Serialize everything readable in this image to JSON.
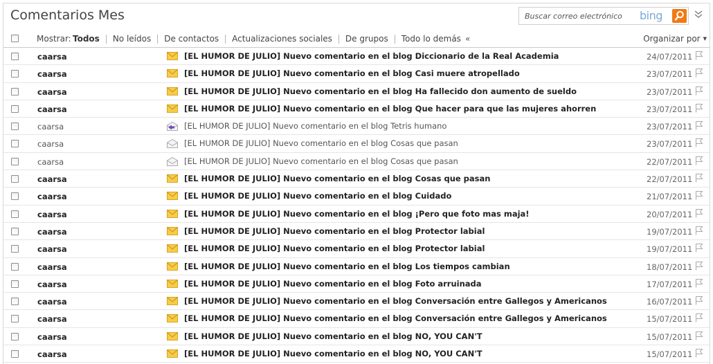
{
  "header": {
    "title": "Comentarios Mes",
    "search_placeholder": "Buscar correo electrónico",
    "search_brand": "bing"
  },
  "filterbar": {
    "show_label": "Mostrar:",
    "filters": [
      "Todos",
      "No leídos",
      "De contactos",
      "Actualizaciones sociales",
      "De grupos",
      "Todo lo demás"
    ],
    "active_filter": "Todos",
    "collapse_glyph": "«",
    "organize_label": "Organizar por"
  },
  "colors": {
    "accent_orange": "#f07a14",
    "bing_blue": "#7aa8d8",
    "envelope_unread": "#f0c23a",
    "envelope_reply": "#6a4bc4"
  },
  "messages": [
    {
      "sender": "caarsa",
      "subject": "[EL HUMOR DE JULIO] Nuevo comentario en el blog Diccionario de la Real Academia",
      "date": "24/07/2011",
      "unread": true,
      "icon": "envelope-unread-icon"
    },
    {
      "sender": "caarsa",
      "subject": "[EL HUMOR DE JULIO] Nuevo comentario en el blog Casi muere atropellado",
      "date": "23/07/2011",
      "unread": true,
      "icon": "envelope-unread-icon"
    },
    {
      "sender": "caarsa",
      "subject": "[EL HUMOR DE JULIO] Nuevo comentario en el blog Ha fallecido don aumento de sueldo",
      "date": "23/07/2011",
      "unread": true,
      "icon": "envelope-unread-icon"
    },
    {
      "sender": "caarsa",
      "subject": "[EL HUMOR DE JULIO] Nuevo comentario en el blog Que hacer para que las mujeres ahorren",
      "date": "23/07/2011",
      "unread": true,
      "icon": "envelope-unread-icon"
    },
    {
      "sender": "caarsa",
      "subject": "[EL HUMOR DE JULIO] Nuevo comentario en el blog Tetris humano",
      "date": "23/07/2011",
      "unread": false,
      "icon": "envelope-replied-icon"
    },
    {
      "sender": "caarsa",
      "subject": "[EL HUMOR DE JULIO] Nuevo comentario en el blog Cosas que pasan",
      "date": "23/07/2011",
      "unread": false,
      "icon": "envelope-open-icon"
    },
    {
      "sender": "caarsa",
      "subject": "[EL HUMOR DE JULIO] Nuevo comentario en el blog Cosas que pasan",
      "date": "22/07/2011",
      "unread": false,
      "icon": "envelope-open-icon"
    },
    {
      "sender": "caarsa",
      "subject": "[EL HUMOR DE JULIO] Nuevo comentario en el blog Cosas que pasan",
      "date": "22/07/2011",
      "unread": true,
      "icon": "envelope-unread-icon"
    },
    {
      "sender": "caarsa",
      "subject": "[EL HUMOR DE JULIO] Nuevo comentario en el blog Cuidado",
      "date": "21/07/2011",
      "unread": true,
      "icon": "envelope-unread-icon"
    },
    {
      "sender": "caarsa",
      "subject": "[EL HUMOR DE JULIO] Nuevo comentario en el blog ¡Pero que foto mas maja!",
      "date": "20/07/2011",
      "unread": true,
      "icon": "envelope-unread-icon"
    },
    {
      "sender": "caarsa",
      "subject": "[EL HUMOR DE JULIO] Nuevo comentario en el blog Protector labial",
      "date": "19/07/2011",
      "unread": true,
      "icon": "envelope-unread-icon"
    },
    {
      "sender": "caarsa",
      "subject": "[EL HUMOR DE JULIO] Nuevo comentario en el blog Protector labial",
      "date": "19/07/2011",
      "unread": true,
      "icon": "envelope-unread-icon"
    },
    {
      "sender": "caarsa",
      "subject": "[EL HUMOR DE JULIO] Nuevo comentario en el blog Los tiempos cambian",
      "date": "18/07/2011",
      "unread": true,
      "icon": "envelope-unread-icon"
    },
    {
      "sender": "caarsa",
      "subject": "[EL HUMOR DE JULIO] Nuevo comentario en el blog Foto arruinada",
      "date": "17/07/2011",
      "unread": true,
      "icon": "envelope-unread-icon"
    },
    {
      "sender": "caarsa",
      "subject": "[EL HUMOR DE JULIO] Nuevo comentario en el blog Conversación entre Gallegos y Americanos",
      "date": "16/07/2011",
      "unread": true,
      "icon": "envelope-unread-icon"
    },
    {
      "sender": "caarsa",
      "subject": "[EL HUMOR DE JULIO] Nuevo comentario en el blog Conversación entre Gallegos y Americanos",
      "date": "15/07/2011",
      "unread": true,
      "icon": "envelope-unread-icon"
    },
    {
      "sender": "caarsa",
      "subject": "[EL HUMOR DE JULIO] Nuevo comentario en el blog NO, YOU CAN'T",
      "date": "15/07/2011",
      "unread": true,
      "icon": "envelope-unread-icon"
    },
    {
      "sender": "caarsa",
      "subject": "[EL HUMOR DE JULIO] Nuevo comentario en el blog NO, YOU CAN'T",
      "date": "15/07/2011",
      "unread": true,
      "icon": "envelope-unread-icon"
    }
  ]
}
